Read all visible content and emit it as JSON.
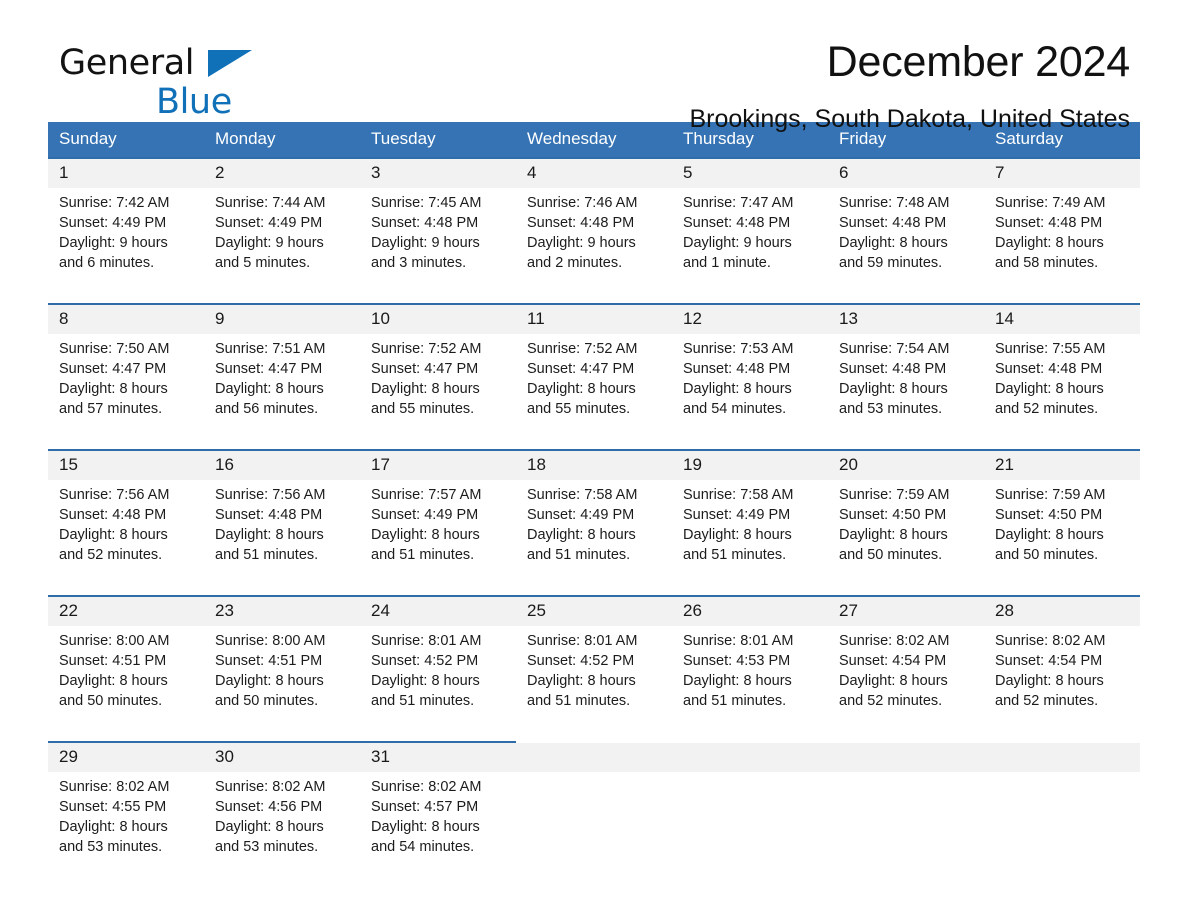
{
  "brand": {
    "word1": "General",
    "word2": "Blue",
    "flag_icon": "triangle-flag-icon",
    "accent_color": "#1071b8"
  },
  "header": {
    "title": "December 2024",
    "subtitle": "Brookings, South Dakota, United States"
  },
  "theme": {
    "header_row_bg": "#3573b4",
    "daynum_bg": "#f2f2f2",
    "separator": "#2e6da8",
    "text": "#1a1a1a"
  },
  "weekday_headers": [
    "Sunday",
    "Monday",
    "Tuesday",
    "Wednesday",
    "Thursday",
    "Friday",
    "Saturday"
  ],
  "weeks": [
    {
      "days": [
        {
          "num": "1",
          "sunrise": "Sunrise: 7:42 AM",
          "sunset": "Sunset: 4:49 PM",
          "daylight1": "Daylight: 9 hours",
          "daylight2": "and 6 minutes."
        },
        {
          "num": "2",
          "sunrise": "Sunrise: 7:44 AM",
          "sunset": "Sunset: 4:49 PM",
          "daylight1": "Daylight: 9 hours",
          "daylight2": "and 5 minutes."
        },
        {
          "num": "3",
          "sunrise": "Sunrise: 7:45 AM",
          "sunset": "Sunset: 4:48 PM",
          "daylight1": "Daylight: 9 hours",
          "daylight2": "and 3 minutes."
        },
        {
          "num": "4",
          "sunrise": "Sunrise: 7:46 AM",
          "sunset": "Sunset: 4:48 PM",
          "daylight1": "Daylight: 9 hours",
          "daylight2": "and 2 minutes."
        },
        {
          "num": "5",
          "sunrise": "Sunrise: 7:47 AM",
          "sunset": "Sunset: 4:48 PM",
          "daylight1": "Daylight: 9 hours",
          "daylight2": "and 1 minute."
        },
        {
          "num": "6",
          "sunrise": "Sunrise: 7:48 AM",
          "sunset": "Sunset: 4:48 PM",
          "daylight1": "Daylight: 8 hours",
          "daylight2": "and 59 minutes."
        },
        {
          "num": "7",
          "sunrise": "Sunrise: 7:49 AM",
          "sunset": "Sunset: 4:48 PM",
          "daylight1": "Daylight: 8 hours",
          "daylight2": "and 58 minutes."
        }
      ]
    },
    {
      "days": [
        {
          "num": "8",
          "sunrise": "Sunrise: 7:50 AM",
          "sunset": "Sunset: 4:47 PM",
          "daylight1": "Daylight: 8 hours",
          "daylight2": "and 57 minutes."
        },
        {
          "num": "9",
          "sunrise": "Sunrise: 7:51 AM",
          "sunset": "Sunset: 4:47 PM",
          "daylight1": "Daylight: 8 hours",
          "daylight2": "and 56 minutes."
        },
        {
          "num": "10",
          "sunrise": "Sunrise: 7:52 AM",
          "sunset": "Sunset: 4:47 PM",
          "daylight1": "Daylight: 8 hours",
          "daylight2": "and 55 minutes."
        },
        {
          "num": "11",
          "sunrise": "Sunrise: 7:52 AM",
          "sunset": "Sunset: 4:47 PM",
          "daylight1": "Daylight: 8 hours",
          "daylight2": "and 55 minutes."
        },
        {
          "num": "12",
          "sunrise": "Sunrise: 7:53 AM",
          "sunset": "Sunset: 4:48 PM",
          "daylight1": "Daylight: 8 hours",
          "daylight2": "and 54 minutes."
        },
        {
          "num": "13",
          "sunrise": "Sunrise: 7:54 AM",
          "sunset": "Sunset: 4:48 PM",
          "daylight1": "Daylight: 8 hours",
          "daylight2": "and 53 minutes."
        },
        {
          "num": "14",
          "sunrise": "Sunrise: 7:55 AM",
          "sunset": "Sunset: 4:48 PM",
          "daylight1": "Daylight: 8 hours",
          "daylight2": "and 52 minutes."
        }
      ]
    },
    {
      "days": [
        {
          "num": "15",
          "sunrise": "Sunrise: 7:56 AM",
          "sunset": "Sunset: 4:48 PM",
          "daylight1": "Daylight: 8 hours",
          "daylight2": "and 52 minutes."
        },
        {
          "num": "16",
          "sunrise": "Sunrise: 7:56 AM",
          "sunset": "Sunset: 4:48 PM",
          "daylight1": "Daylight: 8 hours",
          "daylight2": "and 51 minutes."
        },
        {
          "num": "17",
          "sunrise": "Sunrise: 7:57 AM",
          "sunset": "Sunset: 4:49 PM",
          "daylight1": "Daylight: 8 hours",
          "daylight2": "and 51 minutes."
        },
        {
          "num": "18",
          "sunrise": "Sunrise: 7:58 AM",
          "sunset": "Sunset: 4:49 PM",
          "daylight1": "Daylight: 8 hours",
          "daylight2": "and 51 minutes."
        },
        {
          "num": "19",
          "sunrise": "Sunrise: 7:58 AM",
          "sunset": "Sunset: 4:49 PM",
          "daylight1": "Daylight: 8 hours",
          "daylight2": "and 51 minutes."
        },
        {
          "num": "20",
          "sunrise": "Sunrise: 7:59 AM",
          "sunset": "Sunset: 4:50 PM",
          "daylight1": "Daylight: 8 hours",
          "daylight2": "and 50 minutes."
        },
        {
          "num": "21",
          "sunrise": "Sunrise: 7:59 AM",
          "sunset": "Sunset: 4:50 PM",
          "daylight1": "Daylight: 8 hours",
          "daylight2": "and 50 minutes."
        }
      ]
    },
    {
      "days": [
        {
          "num": "22",
          "sunrise": "Sunrise: 8:00 AM",
          "sunset": "Sunset: 4:51 PM",
          "daylight1": "Daylight: 8 hours",
          "daylight2": "and 50 minutes."
        },
        {
          "num": "23",
          "sunrise": "Sunrise: 8:00 AM",
          "sunset": "Sunset: 4:51 PM",
          "daylight1": "Daylight: 8 hours",
          "daylight2": "and 50 minutes."
        },
        {
          "num": "24",
          "sunrise": "Sunrise: 8:01 AM",
          "sunset": "Sunset: 4:52 PM",
          "daylight1": "Daylight: 8 hours",
          "daylight2": "and 51 minutes."
        },
        {
          "num": "25",
          "sunrise": "Sunrise: 8:01 AM",
          "sunset": "Sunset: 4:52 PM",
          "daylight1": "Daylight: 8 hours",
          "daylight2": "and 51 minutes."
        },
        {
          "num": "26",
          "sunrise": "Sunrise: 8:01 AM",
          "sunset": "Sunset: 4:53 PM",
          "daylight1": "Daylight: 8 hours",
          "daylight2": "and 51 minutes."
        },
        {
          "num": "27",
          "sunrise": "Sunrise: 8:02 AM",
          "sunset": "Sunset: 4:54 PM",
          "daylight1": "Daylight: 8 hours",
          "daylight2": "and 52 minutes."
        },
        {
          "num": "28",
          "sunrise": "Sunrise: 8:02 AM",
          "sunset": "Sunset: 4:54 PM",
          "daylight1": "Daylight: 8 hours",
          "daylight2": "and 52 minutes."
        }
      ]
    },
    {
      "days": [
        {
          "num": "29",
          "sunrise": "Sunrise: 8:02 AM",
          "sunset": "Sunset: 4:55 PM",
          "daylight1": "Daylight: 8 hours",
          "daylight2": "and 53 minutes."
        },
        {
          "num": "30",
          "sunrise": "Sunrise: 8:02 AM",
          "sunset": "Sunset: 4:56 PM",
          "daylight1": "Daylight: 8 hours",
          "daylight2": "and 53 minutes."
        },
        {
          "num": "31",
          "sunrise": "Sunrise: 8:02 AM",
          "sunset": "Sunset: 4:57 PM",
          "daylight1": "Daylight: 8 hours",
          "daylight2": "and 54 minutes."
        },
        {
          "num": "",
          "sunrise": "",
          "sunset": "",
          "daylight1": "",
          "daylight2": ""
        },
        {
          "num": "",
          "sunrise": "",
          "sunset": "",
          "daylight1": "",
          "daylight2": ""
        },
        {
          "num": "",
          "sunrise": "",
          "sunset": "",
          "daylight1": "",
          "daylight2": ""
        },
        {
          "num": "",
          "sunrise": "",
          "sunset": "",
          "daylight1": "",
          "daylight2": ""
        }
      ]
    }
  ]
}
